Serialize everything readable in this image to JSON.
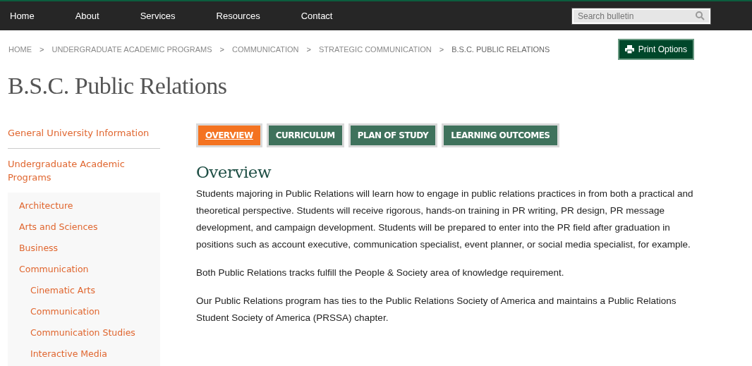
{
  "nav": {
    "items": [
      "Home",
      "About",
      "Services",
      "Resources",
      "Contact"
    ],
    "search": {
      "placeholder": "Search bulletin"
    }
  },
  "breadcrumb": {
    "separator": ">",
    "items": [
      "HOME",
      "UNDERGRADUATE ACADEMIC PROGRAMS",
      "COMMUNICATION",
      "STRATEGIC COMMUNICATION",
      "B.S.C. PUBLIC RELATIONS"
    ]
  },
  "print_button": "Print Options",
  "title": "B.S.C. Public Relations",
  "sidebar": {
    "items": [
      {
        "label": "General University Information"
      },
      {
        "label": "Undergraduate Academic Programs",
        "children": [
          {
            "label": "Architecture"
          },
          {
            "label": "Arts and Sciences"
          },
          {
            "label": "Business"
          },
          {
            "label": "Communication",
            "children": [
              {
                "label": "Cinematic Arts"
              },
              {
                "label": "Communication"
              },
              {
                "label": "Communication Studies"
              },
              {
                "label": "Interactive Media"
              }
            ]
          }
        ]
      }
    ]
  },
  "tabs": [
    {
      "label": "OVERVIEW",
      "selected": true
    },
    {
      "label": "CURRICULUM",
      "selected": false
    },
    {
      "label": "PLAN OF STUDY",
      "selected": false
    },
    {
      "label": "LEARNING OUTCOMES",
      "selected": false
    }
  ],
  "section": {
    "heading": "Overview",
    "paragraphs": [
      "Students majoring in Public Relations will learn how to engage in public relations practices in from both a practical and theoretical perspective. Students will receive rigorous, hands-on training in PR writing, PR design, PR message development, and campaign development. Students will be prepared to enter into the PR field after graduation in positions such as account executive, communication specialist, event planner, or social media specialist, for example.",
      "Both Public Relations tracks fulfill the People & Society area of knowledge requirement.",
      "Our Public Relations program has ties to the Public Relations Society of America and maintains a Public Relations Student Society of America (PRSSA) chapter."
    ]
  }
}
